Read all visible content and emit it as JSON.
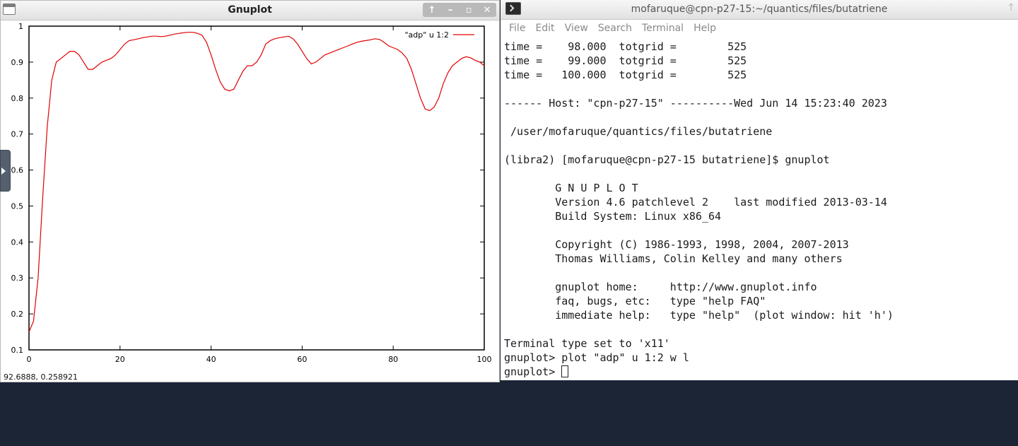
{
  "gnuplot_window": {
    "title": "Gnuplot",
    "controls": [
      "↑",
      "–",
      "▫",
      "✕"
    ],
    "status": "92.6888,  0.258921"
  },
  "chart_data": {
    "type": "line",
    "title": "",
    "xlabel": "",
    "ylabel": "",
    "xlim": [
      0,
      100
    ],
    "ylim": [
      0.1,
      1.0
    ],
    "grid": false,
    "legend_position": "top-right",
    "xticks": [
      "0",
      "20",
      "40",
      "60",
      "80",
      "100"
    ],
    "yticks": [
      "0.1",
      "0.2",
      "0.3",
      "0.4",
      "0.5",
      "0.6",
      "0.7",
      "0.8",
      "0.9",
      "1"
    ],
    "series": [
      {
        "name": "\"adp\" u 1:2",
        "color": "#e00000",
        "x": [
          0,
          1,
          2,
          3,
          4,
          5,
          6,
          7,
          8,
          9,
          10,
          11,
          12,
          13,
          14,
          15,
          16,
          17,
          18,
          19,
          20,
          21,
          22,
          23,
          24,
          25,
          26,
          27,
          28,
          29,
          30,
          31,
          32,
          33,
          34,
          35,
          36,
          37,
          38,
          39,
          40,
          41,
          42,
          43,
          44,
          45,
          46,
          47,
          48,
          49,
          50,
          51,
          52,
          53,
          54,
          55,
          56,
          57,
          58,
          59,
          60,
          61,
          62,
          63,
          64,
          65,
          66,
          67,
          68,
          69,
          70,
          71,
          72,
          73,
          74,
          75,
          76,
          77,
          78,
          79,
          80,
          81,
          82,
          83,
          84,
          85,
          86,
          87,
          88,
          89,
          90,
          91,
          92,
          93,
          94,
          95,
          96,
          97,
          98,
          99,
          100
        ],
        "y": [
          0.15,
          0.18,
          0.3,
          0.52,
          0.72,
          0.85,
          0.9,
          0.91,
          0.92,
          0.93,
          0.93,
          0.92,
          0.9,
          0.88,
          0.88,
          0.89,
          0.9,
          0.905,
          0.91,
          0.92,
          0.935,
          0.95,
          0.96,
          0.962,
          0.965,
          0.968,
          0.97,
          0.972,
          0.972,
          0.971,
          0.972,
          0.975,
          0.978,
          0.98,
          0.982,
          0.983,
          0.983,
          0.98,
          0.975,
          0.955,
          0.92,
          0.88,
          0.845,
          0.825,
          0.82,
          0.825,
          0.85,
          0.875,
          0.89,
          0.89,
          0.9,
          0.92,
          0.95,
          0.96,
          0.965,
          0.968,
          0.97,
          0.972,
          0.965,
          0.95,
          0.93,
          0.91,
          0.895,
          0.9,
          0.91,
          0.92,
          0.925,
          0.93,
          0.935,
          0.94,
          0.945,
          0.95,
          0.955,
          0.958,
          0.96,
          0.962,
          0.965,
          0.963,
          0.955,
          0.945,
          0.94,
          0.935,
          0.925,
          0.91,
          0.88,
          0.84,
          0.8,
          0.77,
          0.765,
          0.775,
          0.8,
          0.84,
          0.87,
          0.89,
          0.9,
          0.91,
          0.915,
          0.912,
          0.905,
          0.9,
          0.89
        ]
      }
    ]
  },
  "terminal_window": {
    "title": "mofaruque@cpn-p27-15:~/quantics/files/butatriene",
    "menu": [
      "File",
      "Edit",
      "View",
      "Search",
      "Terminal",
      "Help"
    ],
    "lines": [
      "time =    98.000  totgrid =        525",
      "time =    99.000  totgrid =        525",
      "time =   100.000  totgrid =        525",
      "",
      "------ Host: \"cpn-p27-15\" ----------Wed Jun 14 15:23:40 2023",
      "",
      " /user/mofaruque/quantics/files/butatriene",
      "",
      "(libra2) [mofaruque@cpn-p27-15 butatriene]$ gnuplot",
      "",
      "        G N U P L O T",
      "        Version 4.6 patchlevel 2    last modified 2013-03-14",
      "        Build System: Linux x86_64",
      "",
      "        Copyright (C) 1986-1993, 1998, 2004, 2007-2013",
      "        Thomas Williams, Colin Kelley and many others",
      "",
      "        gnuplot home:     http://www.gnuplot.info",
      "        faq, bugs, etc:   type \"help FAQ\"",
      "        immediate help:   type \"help\"  (plot window: hit 'h')",
      "",
      "Terminal type set to 'x11'",
      "gnuplot> plot \"adp\" u 1:2 w l"
    ],
    "prompt": "gnuplot> "
  }
}
